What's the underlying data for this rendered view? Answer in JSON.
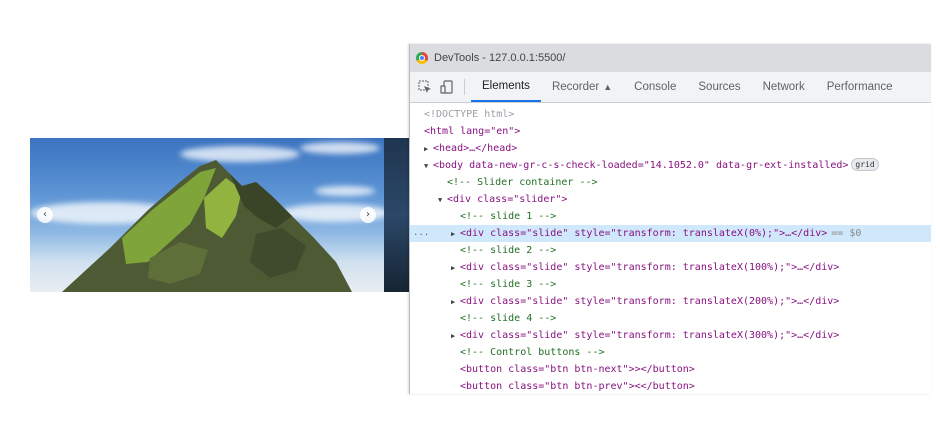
{
  "window": {
    "title": "DevTools - 127.0.0.1:5500/"
  },
  "toolbar": {
    "inspect_icon": "cursor-select-icon",
    "device_icon": "device-toggle-icon"
  },
  "tabs": [
    {
      "label": "Elements",
      "active": true
    },
    {
      "label": "Recorder",
      "icon": "flask-icon"
    },
    {
      "label": "Console"
    },
    {
      "label": "Sources"
    },
    {
      "label": "Network"
    },
    {
      "label": "Performance"
    }
  ],
  "dom": {
    "doctype": "<!DOCTYPE html>",
    "html_open": "<html lang=\"en\">",
    "head": "<head>…</head>",
    "body_open": "<body data-new-gr-c-s-check-loaded=\"14.1052.0\" data-gr-ext-installed>",
    "grid_badge": "grid",
    "comment_slider": "<!-- Slider container -->",
    "slider_div": "<div class=\"slider\">",
    "comment_slide1": "<!-- slide 1 -->",
    "slide1": "<div class=\"slide\" style=\"transform: translateX(0%);\">…</div>",
    "selected_marker": "== $0",
    "comment_slide2": "<!-- slide 2 -->",
    "slide2": "<div class=\"slide\" style=\"transform: translateX(100%);\">…</div>",
    "comment_slide3": "<!-- slide 3 -->",
    "slide3": "<div class=\"slide\" style=\"transform: translateX(200%);\">…</div>",
    "comment_slide4": "<!-- slide 4 -->",
    "slide4": "<div class=\"slide\" style=\"transform: translateX(300%);\">…</div>",
    "comment_controls": "<!-- Control buttons -->",
    "btn_next": "<button class=\"btn btn-next\">></button>",
    "btn_prev": "<button class=\"btn btn-prev\"><</button>",
    "gutter": "..."
  },
  "slider": {
    "prev_glyph": "‹",
    "next_glyph": "›"
  }
}
